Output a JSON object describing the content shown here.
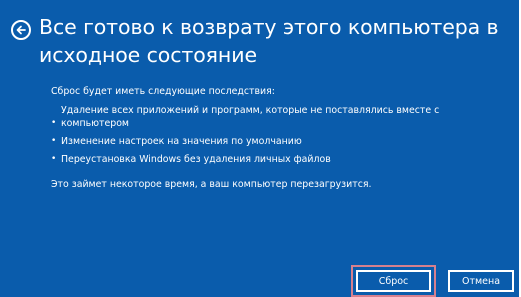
{
  "window": {
    "title": "Все готово к возврату этого компьютера в исходное состояние"
  },
  "content": {
    "intro": "Сброс будет иметь следующие последствия:",
    "bullets": [
      "Удаление всех приложений и программ, которые не поставлялись вместе с компьютером",
      "Изменение настроек на значения по умолчанию",
      "Переустановка Windows без удаления личных файлов"
    ],
    "note": "Это займет некоторое время, а ваш компьютер перезагрузится."
  },
  "buttons": {
    "reset_label": "Сброс",
    "cancel_label": "Отмена"
  },
  "icons": {
    "back": "back-arrow-icon"
  },
  "colors": {
    "background": "#0a5cac",
    "text": "#ffffff",
    "button_highlight": "#d6808e"
  }
}
